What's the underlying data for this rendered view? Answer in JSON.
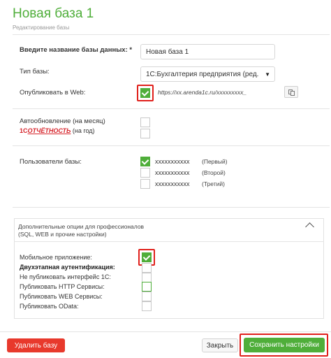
{
  "header": {
    "title": "Новая база 1",
    "subtitle": "Редактирование базы"
  },
  "form": {
    "name_label": "Введите название базы данных: *",
    "name_value": "Новая база 1",
    "type_label": "Тип базы:",
    "type_value": "1С:Бухгалтерия предприятия (ред.",
    "publish_label": "Опубликовать в Web:",
    "publish_checked": true,
    "publish_url": "https://xx.arenda1c.ru/xxxxxxxxx_",
    "autoupdate_label": "Автообновление (на месяц)",
    "reporting_logo_one": "1С",
    "reporting_logo_text": "ОТЧЁТНОСТЬ",
    "reporting_label": " (на год)",
    "users_label": "Пользователи базы:"
  },
  "users": [
    {
      "name": "xxxxxxxxxxx",
      "role": "(Первый)",
      "checked": true
    },
    {
      "name": "xxxxxxxxxxx",
      "role": "(Второй)",
      "checked": false
    },
    {
      "name": "xxxxxxxxxxx",
      "role": "(Третий)",
      "checked": false
    }
  ],
  "advanced": {
    "title_line1": "Дополнительные опции для профессионалов",
    "title_line2": "(SQL, WEB и прочие настройки)",
    "options": [
      {
        "label": "Мобильное приложение:",
        "checked": true,
        "bold": false
      },
      {
        "label": "Двухэтапная аутентификация:",
        "checked": false,
        "bold": true
      },
      {
        "label": "Не публиковать интерфейс 1С:",
        "checked": false,
        "bold": false
      },
      {
        "label": "Публиковать HTTP Сервисы:",
        "checked": false,
        "bold": false
      },
      {
        "label": "Публиковать WEB Сервисы:",
        "checked": false,
        "bold": false
      },
      {
        "label": "Публиковать OData:",
        "checked": false,
        "bold": false
      }
    ]
  },
  "footer": {
    "delete_label": "Удалить базу",
    "close_label": "Закрыть",
    "save_label": "Сохранить настройки"
  },
  "colors": {
    "accent_green": "#4fae3a",
    "danger_red": "#e8392c",
    "highlight_red": "#e0201b"
  },
  "icons": {
    "dropdown": "chevron-down-icon",
    "copy": "copy-icon",
    "collapse": "chevron-up-icon",
    "check": "check-icon"
  }
}
